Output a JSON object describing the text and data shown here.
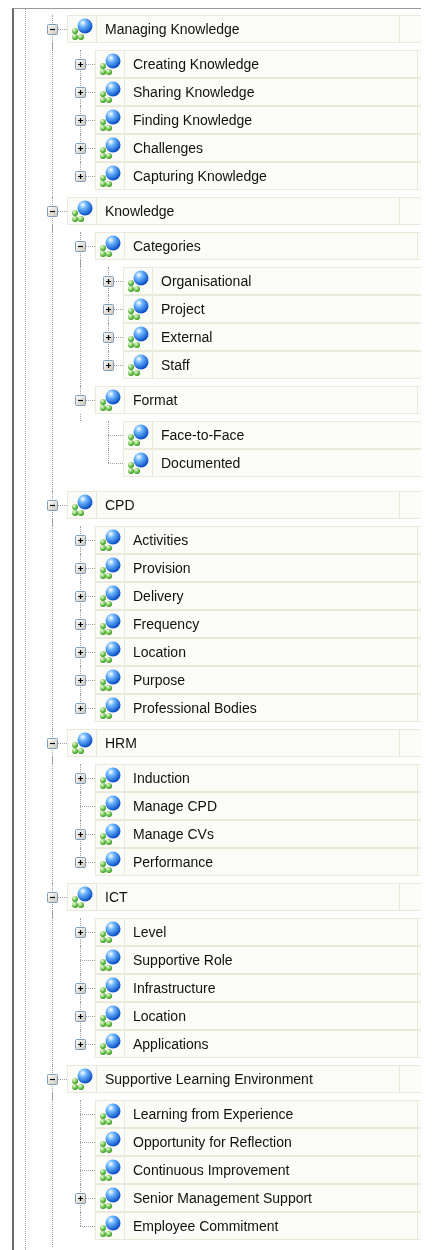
{
  "tree": [
    {
      "label": "Managing Knowledge",
      "kind": "branch",
      "expanded": true,
      "children": [
        {
          "label": "Creating Knowledge",
          "kind": "branch",
          "expanded": false
        },
        {
          "label": "Sharing Knowledge",
          "kind": "branch",
          "expanded": false
        },
        {
          "label": "Finding Knowledge",
          "kind": "branch",
          "expanded": false
        },
        {
          "label": "Challenges",
          "kind": "branch",
          "expanded": false
        },
        {
          "label": "Capturing Knowledge",
          "kind": "branch",
          "expanded": false
        }
      ]
    },
    {
      "label": "Knowledge",
      "kind": "branch",
      "expanded": true,
      "children": [
        {
          "label": "Categories",
          "kind": "branch",
          "expanded": true,
          "children": [
            {
              "label": "Organisational",
              "kind": "branch",
              "expanded": false
            },
            {
              "label": "Project",
              "kind": "branch",
              "expanded": false
            },
            {
              "label": "External",
              "kind": "branch",
              "expanded": false
            },
            {
              "label": "Staff",
              "kind": "branch",
              "expanded": false
            }
          ]
        },
        {
          "label": "Format",
          "kind": "branch",
          "expanded": true,
          "children": [
            {
              "label": "Face-to-Face",
              "kind": "leaf"
            },
            {
              "label": "Documented",
              "kind": "leaf"
            }
          ]
        }
      ]
    },
    {
      "label": "CPD",
      "kind": "branch",
      "expanded": true,
      "children": [
        {
          "label": "Activities",
          "kind": "branch",
          "expanded": false
        },
        {
          "label": "Provision",
          "kind": "branch",
          "expanded": false
        },
        {
          "label": "Delivery",
          "kind": "branch",
          "expanded": false
        },
        {
          "label": "Frequency",
          "kind": "branch",
          "expanded": false
        },
        {
          "label": "Location",
          "kind": "branch",
          "expanded": false
        },
        {
          "label": "Purpose",
          "kind": "branch",
          "expanded": false
        },
        {
          "label": "Professional Bodies",
          "kind": "branch",
          "expanded": false
        }
      ]
    },
    {
      "label": "HRM",
      "kind": "branch",
      "expanded": true,
      "children": [
        {
          "label": "Induction",
          "kind": "branch",
          "expanded": false
        },
        {
          "label": "Manage CPD",
          "kind": "leaf"
        },
        {
          "label": "Manage CVs",
          "kind": "branch",
          "expanded": false
        },
        {
          "label": "Performance",
          "kind": "branch",
          "expanded": false
        }
      ]
    },
    {
      "label": "ICT",
      "kind": "branch",
      "expanded": true,
      "children": [
        {
          "label": "Level",
          "kind": "branch",
          "expanded": false
        },
        {
          "label": "Supportive Role",
          "kind": "leaf"
        },
        {
          "label": "Infrastructure",
          "kind": "branch",
          "expanded": false
        },
        {
          "label": "Location",
          "kind": "branch",
          "expanded": false
        },
        {
          "label": "Applications",
          "kind": "branch",
          "expanded": false
        }
      ]
    },
    {
      "label": "Supportive Learning Environment",
      "kind": "branch",
      "expanded": true,
      "children": [
        {
          "label": "Learning from Experience",
          "kind": "leaf"
        },
        {
          "label": "Opportunity for Reflection",
          "kind": "leaf"
        },
        {
          "label": "Continuous Improvement",
          "kind": "leaf"
        },
        {
          "label": "Senior Management Support",
          "kind": "branch",
          "expanded": false
        },
        {
          "label": "Employee Commitment",
          "kind": "leaf"
        }
      ]
    }
  ]
}
